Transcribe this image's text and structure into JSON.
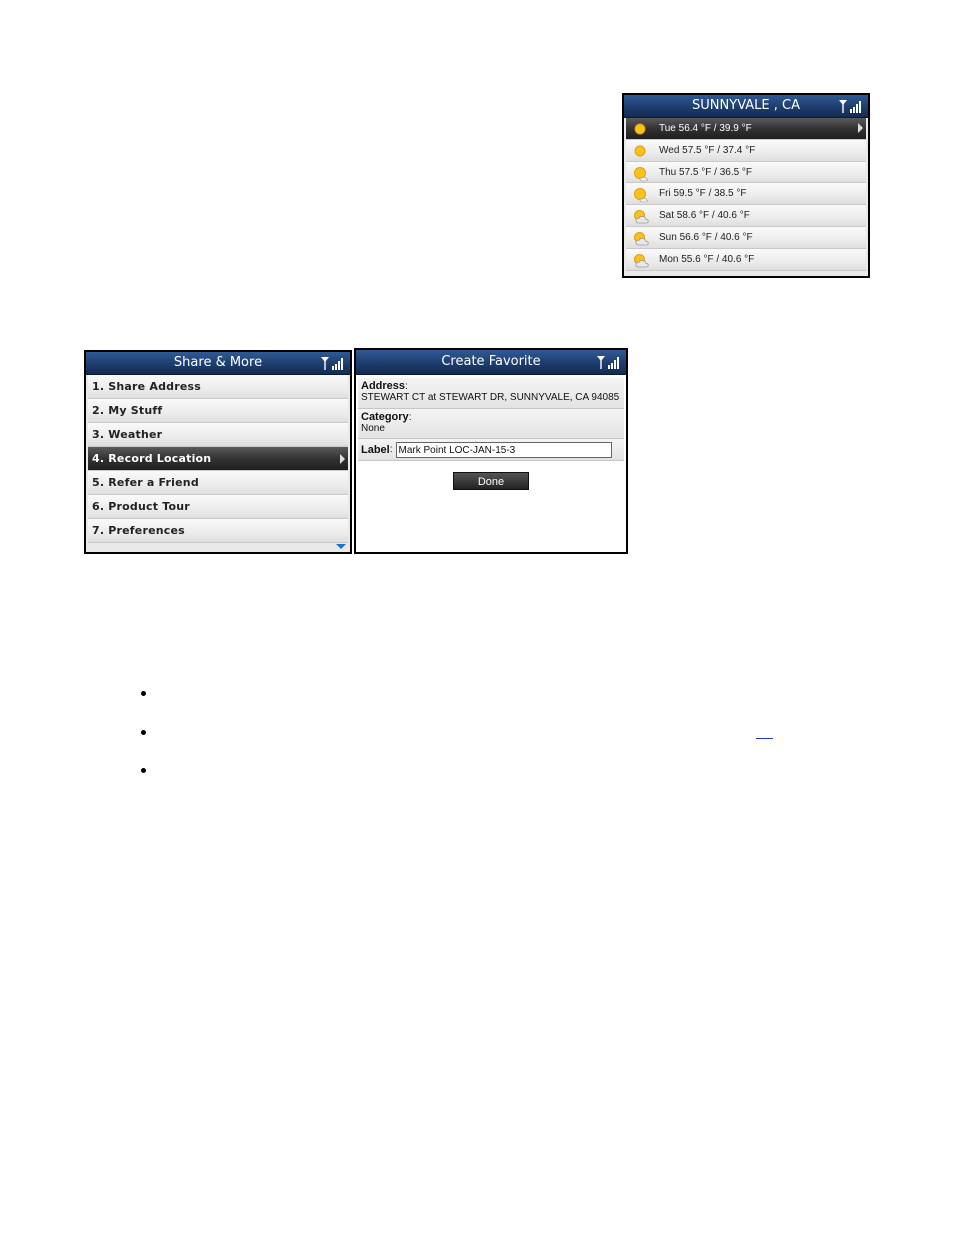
{
  "weather": {
    "title": "SUNNYVALE , CA",
    "days": [
      {
        "text": "Tue 56.4 °F / 39.9 °F",
        "icon": "sun-icon",
        "selected": true
      },
      {
        "text": "Wed 57.5 °F / 37.4 °F",
        "icon": "sun-icon",
        "selected": false
      },
      {
        "text": "Thu 57.5 °F / 36.5 °F",
        "icon": "sun-cloud-icon",
        "selected": false
      },
      {
        "text": "Fri 59.5 °F / 38.5 °F",
        "icon": "sun-cloud-icon",
        "selected": false
      },
      {
        "text": "Sat 58.6 °F / 40.6 °F",
        "icon": "partly-cloudy-icon",
        "selected": false
      },
      {
        "text": "Sun 56.6 °F / 40.6 °F",
        "icon": "partly-cloudy-icon",
        "selected": false
      },
      {
        "text": "Mon 55.6 °F / 40.6 °F",
        "icon": "partly-cloudy-icon",
        "selected": false
      }
    ]
  },
  "menu": {
    "title": "Share & More",
    "items": [
      {
        "label": "1. Share Address",
        "selected": false
      },
      {
        "label": "2. My Stuff",
        "selected": false
      },
      {
        "label": "3. Weather",
        "selected": false
      },
      {
        "label": "4. Record Location",
        "selected": true
      },
      {
        "label": "5. Refer a Friend",
        "selected": false
      },
      {
        "label": "6. Product Tour",
        "selected": false
      },
      {
        "label": "7. Preferences",
        "selected": false
      }
    ]
  },
  "favorite": {
    "title": "Create Favorite",
    "address_label": "Address",
    "address_value": "STEWART CT at STEWART DR, SUNNYVALE, CA 94085",
    "category_label": "Category",
    "category_value": "None",
    "label_label": "Label",
    "label_value": "Mark Point LOC-JAN-15-3",
    "done_label": "Done"
  },
  "colors": {
    "titlebar": "#1d3d6e",
    "selected_row": "#333333",
    "scroll_arrow": "#1f6fd1",
    "link": "#1a3cc8"
  }
}
